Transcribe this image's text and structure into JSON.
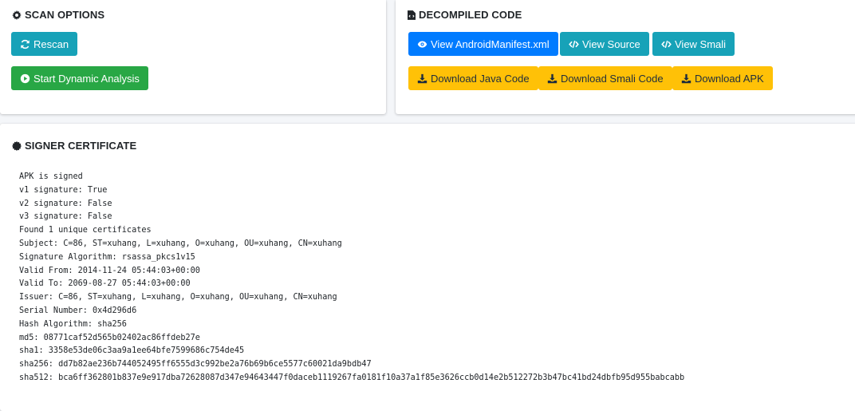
{
  "scan_options": {
    "title": "SCAN OPTIONS",
    "rescan_label": "Rescan",
    "dynamic_label": "Start Dynamic Analysis"
  },
  "decompiled_code": {
    "title": "DECOMPILED CODE",
    "buttons": [
      {
        "label": "View AndroidManifest.xml",
        "icon": "eye-icon",
        "style": "primary"
      },
      {
        "label": "View Source",
        "icon": "code-icon",
        "style": "info"
      },
      {
        "label": "View Smali",
        "icon": "code-icon",
        "style": "info"
      },
      {
        "label": "Download Java Code",
        "icon": "download-icon",
        "style": "warning"
      },
      {
        "label": "Download Smali Code",
        "icon": "download-icon",
        "style": "warning"
      },
      {
        "label": "Download APK",
        "icon": "download-icon",
        "style": "warning"
      }
    ]
  },
  "signer_certificate": {
    "title": "SIGNER CERTIFICATE",
    "lines": [
      "APK is signed",
      "v1 signature: True",
      "v2 signature: False",
      "v3 signature: False",
      "Found 1 unique certificates",
      "Subject: C=86, ST=xuhang, L=xuhang, O=xuhang, OU=xuhang, CN=xuhang",
      "Signature Algorithm: rsassa_pkcs1v15",
      "Valid From: 2014-11-24 05:44:03+00:00",
      "Valid To: 2069-08-27 05:44:03+00:00",
      "Issuer: C=86, ST=xuhang, L=xuhang, O=xuhang, OU=xuhang, CN=xuhang",
      "Serial Number: 0x4d296d6",
      "Hash Algorithm: sha256",
      "md5: 08771caf52d565b02402ac86ffdeb27e",
      "sha1: 3358e53de06c3aa9a1ee64bfe7599686c754de45",
      "sha256: dd7b82ae236b744052495ff6555d3c992be2a76b69b6ce5577c60021da9bdb47",
      "sha512: bca6ff362801b837e9e917dba72628087d347e94643447f0daceb1119267fa0181f10a37a1f85e3626ccb0d14e2b512272b3b47bc41bd24dbfb95d955babcabb"
    ]
  },
  "colors": {
    "info": "#17a2b8",
    "success": "#28a745",
    "primary": "#007bff",
    "warning": "#ffc107",
    "background": "#f4f6f9"
  }
}
